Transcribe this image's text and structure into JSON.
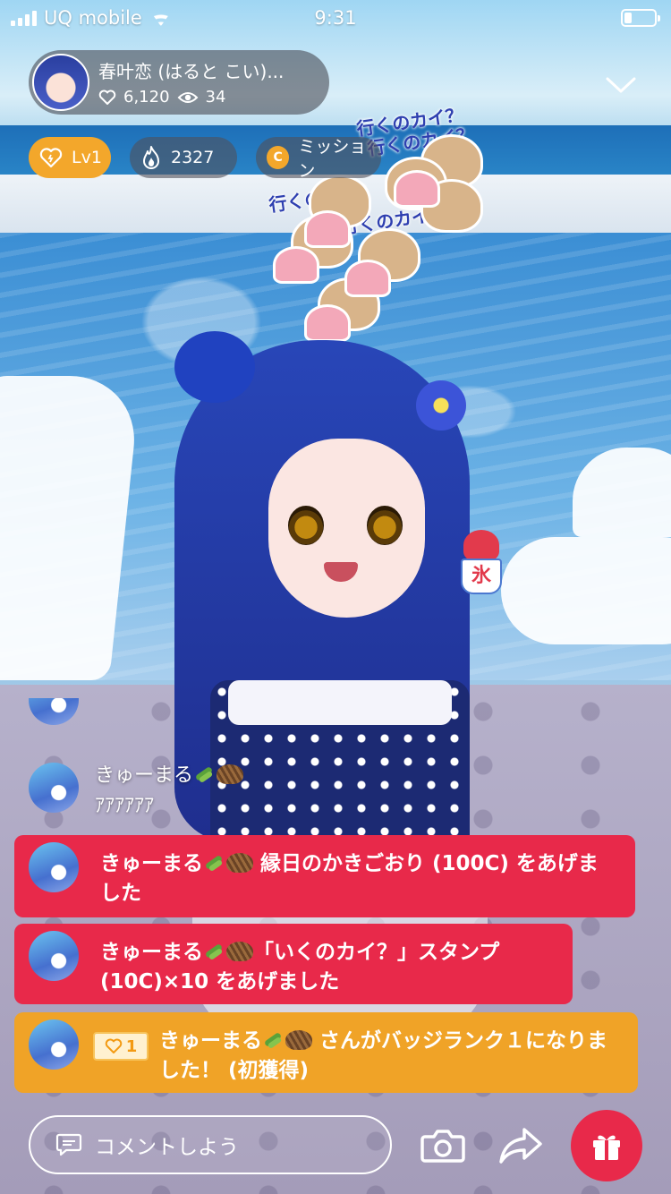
{
  "status_bar": {
    "carrier": "UQ mobile",
    "time": "9:31"
  },
  "streamer": {
    "name": "春叶恋 (はると こい)...",
    "likes": "6,120",
    "viewers": "34"
  },
  "chips": {
    "level": "Lv1",
    "points": "2327",
    "mission": "ミッション",
    "coin_letter": "C"
  },
  "stickers": {
    "label": "行くのカイ？"
  },
  "shaved_ice_mark": "氷",
  "comments": {
    "plain": {
      "name": "きゅーまる",
      "text": "ｱｱｱｱｱｱ"
    },
    "gift1": {
      "name": "きゅーまる",
      "text": " 縁日のかきごおり (100C) をあげました"
    },
    "gift2": {
      "name": "きゅーまる",
      "text": "「いくのカイ？」スタンプ (10C)×10 をあげました"
    },
    "badge": {
      "level": "1",
      "name": "きゅーまる",
      "text": " さんがバッジランク１になりました！ (初獲得)"
    }
  },
  "input": {
    "placeholder": "コメントしよう"
  }
}
